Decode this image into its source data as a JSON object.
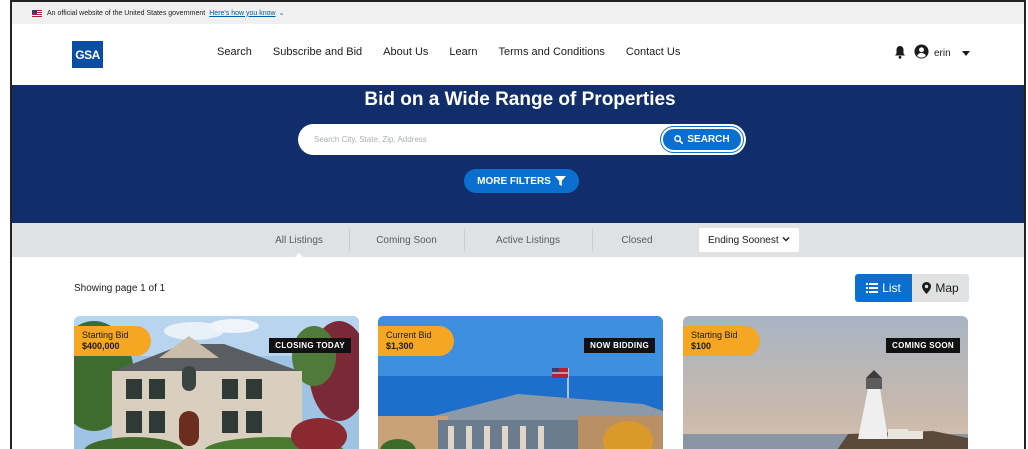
{
  "gov_banner": {
    "text": "An official website of the United States government",
    "link": "Here's how you know"
  },
  "header": {
    "logo_text": "GSA",
    "nav": [
      "Search",
      "Subscribe and Bid",
      "About Us",
      "Learn",
      "Terms and Conditions",
      "Contact Us"
    ],
    "user_name": "erin"
  },
  "hero": {
    "title": "Bid on a Wide Range of Properties",
    "search_placeholder": "Search City, State, Zip, Address",
    "search_button": "SEARCH",
    "filters_button": "MORE FILTERS"
  },
  "tabs": {
    "items": [
      "All Listings",
      "Coming Soon",
      "Active Listings",
      "Closed"
    ],
    "sort_selected": "Ending Soonest"
  },
  "results": {
    "showing": "Showing page 1 of 1",
    "view_list": "List",
    "view_map": "Map"
  },
  "listings": [
    {
      "bid_label": "Starting Bid",
      "bid_amount": "$400,000",
      "status": "CLOSING TODAY"
    },
    {
      "bid_label": "Current Bid",
      "bid_amount": "$1,300",
      "status": "NOW BIDDING"
    },
    {
      "bid_label": "Starting Bid",
      "bid_amount": "$100",
      "status": "COMING SOON"
    }
  ],
  "colors": {
    "hero_bg": "#112e6b",
    "primary_blue": "#0b6fcf",
    "bid_pill": "#f5a623",
    "tabs_bg": "#dfe1e2"
  }
}
